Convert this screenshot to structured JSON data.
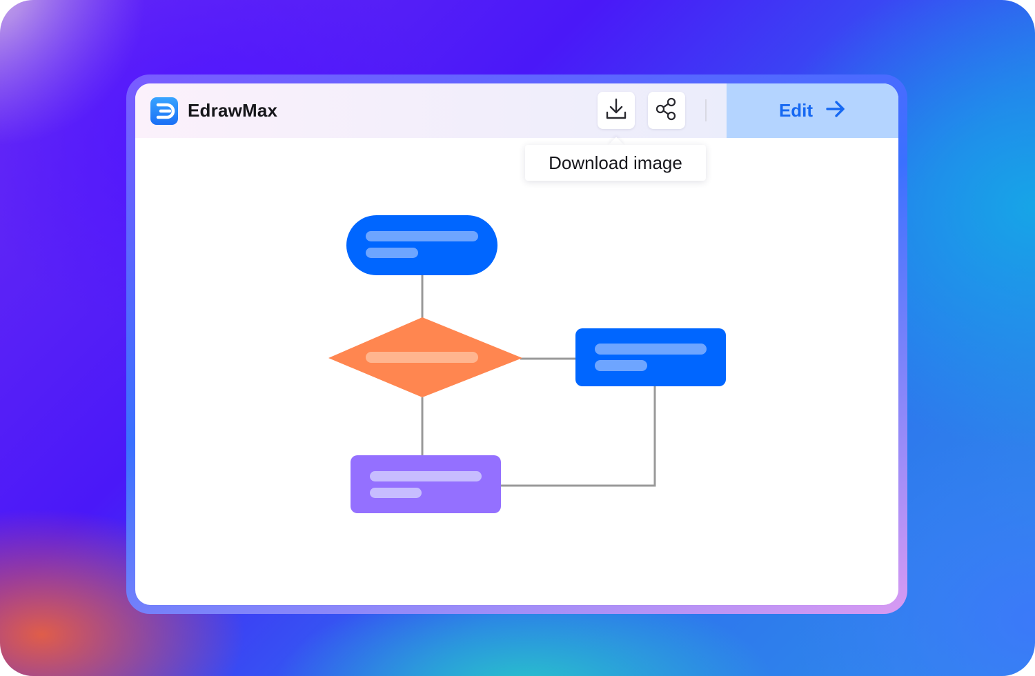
{
  "app": {
    "name": "EdrawMax"
  },
  "toolbar": {
    "download_icon": "download-icon",
    "share_icon": "share-icon",
    "edit_label": "Edit",
    "edit_icon": "arrow-right-icon"
  },
  "tooltip": {
    "text": "Download image"
  },
  "colors": {
    "accent": "#1668f2",
    "terminator": "#0066ff",
    "process": "#0066ff",
    "decision": "#ff8650",
    "subprocess": "#9470ff",
    "connector": "#999999",
    "placeholder_on_blue": "#6ea5ff",
    "placeholder_on_orange": "#ffb58f",
    "placeholder_on_purple": "#c7bdff"
  },
  "diagram": {
    "nodes": [
      {
        "id": "start",
        "shape": "terminator"
      },
      {
        "id": "decision",
        "shape": "decision"
      },
      {
        "id": "process",
        "shape": "process"
      },
      {
        "id": "subprocess",
        "shape": "process"
      }
    ],
    "edges": [
      {
        "from": "start",
        "to": "decision"
      },
      {
        "from": "decision",
        "to": "process"
      },
      {
        "from": "decision",
        "to": "subprocess"
      },
      {
        "from": "subprocess",
        "to": "process"
      }
    ]
  }
}
